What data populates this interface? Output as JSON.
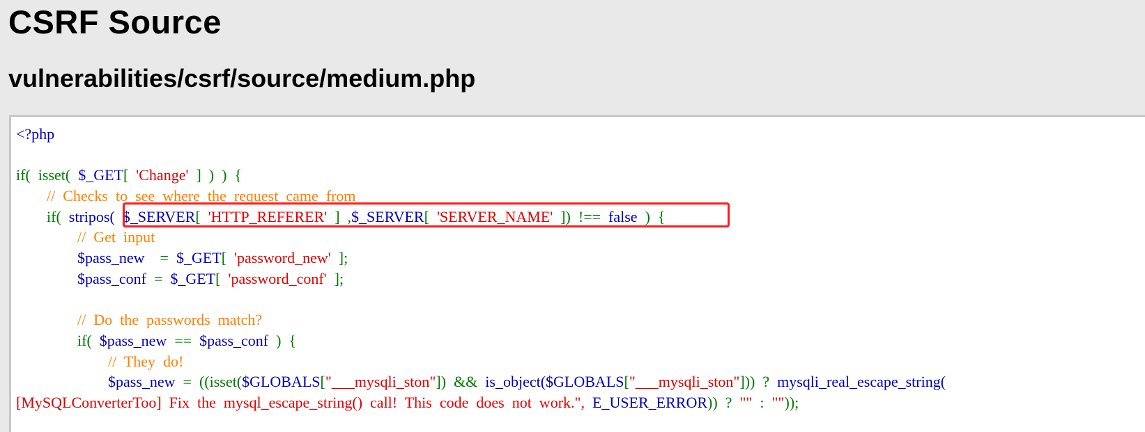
{
  "page": {
    "title": "CSRF Source",
    "subtitle": "vulnerabilities/csrf/source/medium.php"
  },
  "code": {
    "lines": [
      [
        {
          "t": "<?php",
          "c": "php"
        }
      ],
      [],
      [
        {
          "t": "if(  isset(  ",
          "c": "kw"
        },
        {
          "t": "$_GET",
          "c": "var"
        },
        {
          "t": "[  ",
          "c": "kw"
        },
        {
          "t": "'Change'",
          "c": "str"
        },
        {
          "t": "  ]  )  )  {",
          "c": "kw"
        }
      ],
      [
        {
          "t": "        ",
          "c": "kw"
        },
        {
          "t": "//  Checks  to  see  where  the  request  came  from",
          "c": "cmt"
        }
      ],
      [
        {
          "t": "        if(  ",
          "c": "kw"
        },
        {
          "t": "stripos(  ",
          "c": "var"
        },
        {
          "t": "$_SERVER",
          "c": "var"
        },
        {
          "t": "[  ",
          "c": "kw"
        },
        {
          "t": "'HTTP_REFERER'",
          "c": "str"
        },
        {
          "t": "  ]  ,",
          "c": "kw"
        },
        {
          "t": "$_SERVER",
          "c": "var"
        },
        {
          "t": "[  ",
          "c": "kw"
        },
        {
          "t": "'SERVER_NAME'",
          "c": "str"
        },
        {
          "t": "  ])  ",
          "c": "kw"
        },
        {
          "t": "!==  ",
          "c": "kw"
        },
        {
          "t": "false",
          "c": "var"
        },
        {
          "t": "  )  {",
          "c": "kw"
        }
      ],
      [
        {
          "t": "                ",
          "c": "kw"
        },
        {
          "t": "//  Get  input",
          "c": "cmt"
        }
      ],
      [
        {
          "t": "                ",
          "c": "kw"
        },
        {
          "t": "$pass_new",
          "c": "var"
        },
        {
          "t": "    =  ",
          "c": "kw"
        },
        {
          "t": "$_GET",
          "c": "var"
        },
        {
          "t": "[  ",
          "c": "kw"
        },
        {
          "t": "'password_new'",
          "c": "str"
        },
        {
          "t": "  ];",
          "c": "kw"
        }
      ],
      [
        {
          "t": "                ",
          "c": "kw"
        },
        {
          "t": "$pass_conf",
          "c": "var"
        },
        {
          "t": "  =  ",
          "c": "kw"
        },
        {
          "t": "$_GET",
          "c": "var"
        },
        {
          "t": "[  ",
          "c": "kw"
        },
        {
          "t": "'password_conf'",
          "c": "str"
        },
        {
          "t": "  ];",
          "c": "kw"
        }
      ],
      [],
      [
        {
          "t": "                ",
          "c": "kw"
        },
        {
          "t": "//  Do  the  passwords  match?",
          "c": "cmt"
        }
      ],
      [
        {
          "t": "                if(  ",
          "c": "kw"
        },
        {
          "t": "$pass_new",
          "c": "var"
        },
        {
          "t": "  ==  ",
          "c": "kw"
        },
        {
          "t": "$pass_conf",
          "c": "var"
        },
        {
          "t": "  )  {",
          "c": "kw"
        }
      ],
      [
        {
          "t": "                        ",
          "c": "kw"
        },
        {
          "t": "//  They  do!",
          "c": "cmt"
        }
      ],
      [
        {
          "t": "                        ",
          "c": "kw"
        },
        {
          "t": "$pass_new",
          "c": "var"
        },
        {
          "t": "  =  ",
          "c": "kw"
        },
        {
          "t": "((isset(",
          "c": "kw"
        },
        {
          "t": "$GLOBALS",
          "c": "var"
        },
        {
          "t": "[",
          "c": "kw"
        },
        {
          "t": "\"___mysqli_ston\"",
          "c": "str"
        },
        {
          "t": "])  &&  ",
          "c": "kw"
        },
        {
          "t": "is_object(",
          "c": "var"
        },
        {
          "t": "$GLOBALS",
          "c": "var"
        },
        {
          "t": "[",
          "c": "kw"
        },
        {
          "t": "\"___mysqli_ston\"",
          "c": "str"
        },
        {
          "t": "]))  ?  ",
          "c": "kw"
        },
        {
          "t": "mysqli_real_escape_string(",
          "c": "var"
        }
      ],
      [
        {
          "t": "[MySQLConverterToo]  Fix  the  mysql_escape_string()  call!  This  code  does  not  work.\",",
          "c": "str"
        },
        {
          "t": "  ",
          "c": "kw"
        },
        {
          "t": "E_USER_ERROR",
          "c": "var"
        },
        {
          "t": "))  ?  ",
          "c": "kw"
        },
        {
          "t": "\"\"",
          "c": "str"
        },
        {
          "t": "  :  ",
          "c": "kw"
        },
        {
          "t": "\"\"",
          "c": "str"
        },
        {
          "t": "));",
          "c": "kw"
        }
      ]
    ]
  },
  "highlight": {
    "target": "stripos(  $_SERVER[  'HTTP_REFERER'  ]  ,$_SERVER[  'SERVER_NAME'  ])",
    "color": "#ff1a1a"
  },
  "colors": {
    "background": "#e9e9e9",
    "code_background": "#ffffff",
    "keyword": "#007700",
    "variable": "#0000bb",
    "string": "#dd0000",
    "comment": "#ff8000"
  }
}
